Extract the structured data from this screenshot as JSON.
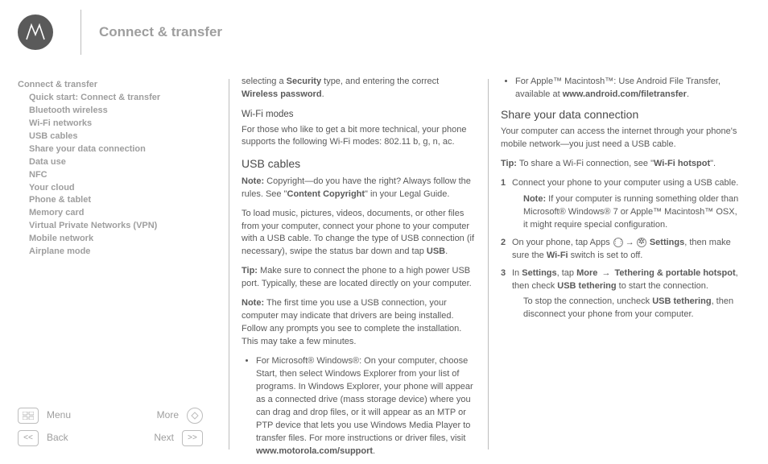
{
  "header": {
    "title": "Connect & transfer"
  },
  "sidebar": {
    "top": "Connect & transfer",
    "items": [
      "Quick start: Connect & transfer",
      "Bluetooth wireless",
      "Wi-Fi networks",
      "USB cables",
      "Share your data connection",
      "Data use",
      "NFC",
      "Your cloud",
      "Phone & tablet",
      "Memory card",
      "Virtual Private Networks (VPN)",
      "Mobile network",
      "Airplane mode"
    ]
  },
  "nav": {
    "menu": "Menu",
    "more": "More",
    "back": "Back",
    "next": "Next"
  },
  "c1": {
    "intro_a": "selecting a ",
    "intro_b": "Security",
    "intro_c": " type, and entering the correct ",
    "intro_d": "Wireless password",
    "intro_e": ".",
    "h3_wifimodes": "Wi-Fi modes",
    "wifimodes": "For those who like to get a bit more technical, your phone supports the following Wi-Fi modes: 802.11 b, g, n, ac.",
    "h2_usb": "USB cables",
    "usb_note_a": "Note:",
    "usb_note_b": " Copyright—do you have the right? Always follow the rules. See \"",
    "usb_note_c": "Content Copyright",
    "usb_note_d": "\" in your Legal Guide.",
    "usb_p1_a": "To load music, pictures, videos, documents, or other files from your computer, connect your phone to your computer with a USB cable. To change the type of USB connection (if necessary), swipe the status bar down and tap ",
    "usb_p1_b": "USB",
    "usb_p1_c": ".",
    "usb_tip_a": "Tip:",
    "usb_tip_b": " Make sure to connect the phone to a high power USB port. Typically, these are located directly on your computer.",
    "usb_note2_a": "Note:",
    "usb_note2_b": " The first time you use a USB connection, your computer may indicate that drivers are being installed. Follow any prompts you see to complete the installation. This may take a few minutes.",
    "bullet1_a": "For Microsoft® Windows®: On your computer, choose Start, then select Windows Explorer from your list of programs. In Windows Explorer, your phone will appear as a connected drive (mass storage device) where you can drag and drop files, or it will appear as an MTP or PTP device that lets you use Windows Media Player to transfer files. For more instructions or driver files, visit ",
    "bullet1_b": "www.motorola.com/support",
    "bullet1_c": "."
  },
  "c2": {
    "bullet2_a": "For Apple™ Macintosh™: Use Android File Transfer, available at ",
    "bullet2_b": "www.android.com/filetransfer",
    "bullet2_c": ".",
    "h2_share": "Share your data connection",
    "share_p1": "Your computer can access the internet through your phone's mobile network—you just need a USB cable.",
    "share_tip_a": "Tip:",
    "share_tip_b": " To share a Wi-Fi connection, see \"",
    "share_tip_c": "Wi-Fi hotspot",
    "share_tip_d": "\".",
    "s1": "Connect your phone to your computer using a USB cable.",
    "s1_note_a": "Note:",
    "s1_note_b": " If your computer is running something older than Microsoft® Windows® 7 or Apple™ Macintosh™ OSX, it might require special configuration.",
    "s2_a": "On your phone, tap Apps ",
    "s2_b": " Settings",
    "s2_c": ", then make sure the ",
    "s2_d": "Wi-Fi",
    "s2_e": " switch is set to off.",
    "s3_a": "In ",
    "s3_b": "Settings",
    "s3_c": ", tap ",
    "s3_d": "More",
    "s3_e": "Tethering & portable hotspot",
    "s3_f": ", then check ",
    "s3_g": "USB tethering",
    "s3_h": " to start the connection.",
    "s3_stop_a": "To stop the connection, uncheck ",
    "s3_stop_b": "USB tethering",
    "s3_stop_c": ", then disconnect your phone from your computer."
  }
}
